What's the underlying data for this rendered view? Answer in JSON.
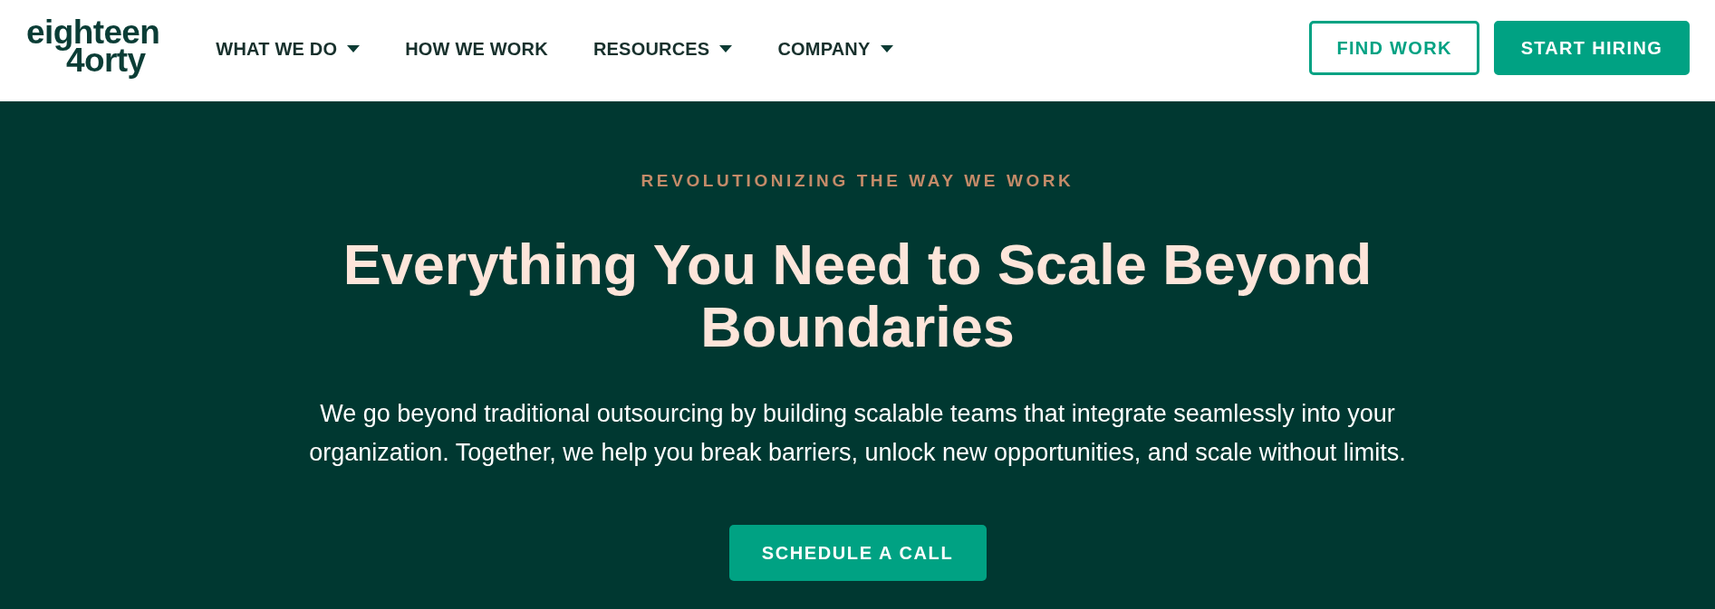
{
  "header": {
    "logo": {
      "lines": [
        "eighteen",
        "4orty"
      ]
    },
    "nav": [
      {
        "label": "WHAT WE DO",
        "dropdown": true
      },
      {
        "label": "HOW WE WORK",
        "dropdown": false
      },
      {
        "label": "RESOURCES",
        "dropdown": true
      },
      {
        "label": "COMPANY",
        "dropdown": true
      }
    ],
    "actions": [
      {
        "label": "FIND WORK",
        "kind": "outline"
      },
      {
        "label": "START HIRING",
        "kind": "solid"
      }
    ]
  },
  "hero": {
    "eyebrow": "REVOLUTIONIZING THE WAY WE WORK",
    "title": "Everything You Need to Scale Beyond Boundaries",
    "description": "We go beyond traditional outsourcing by building scalable teams that integrate seamlessly into your organization. Together, we help you break barriers, unlock new opportunities, and scale without limits.",
    "cta": "SCHEDULE A CALL"
  }
}
